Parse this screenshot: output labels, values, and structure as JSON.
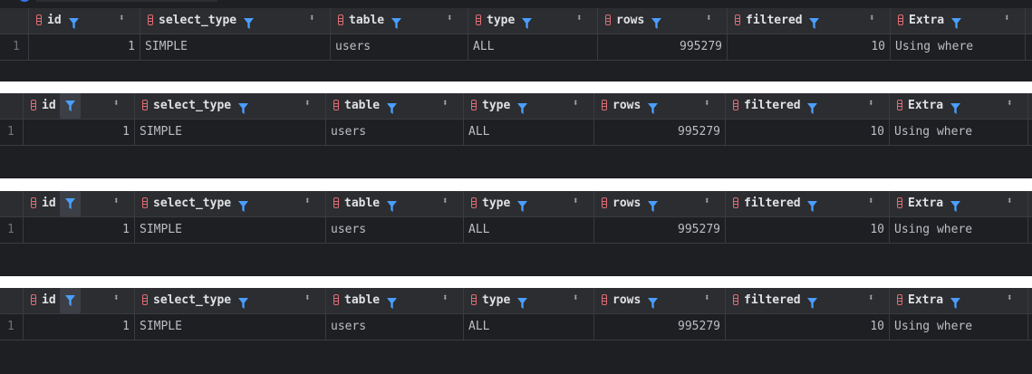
{
  "columns": [
    {
      "name": "id"
    },
    {
      "name": "select_type"
    },
    {
      "name": "table"
    },
    {
      "name": "type"
    },
    {
      "name": "rows"
    },
    {
      "name": "filtered"
    },
    {
      "name": "Extra"
    }
  ],
  "row_number": "1",
  "row": {
    "id": "1",
    "select_type": "SIMPLE",
    "table": "users",
    "type": "ALL",
    "rows": "995279",
    "filtered": "10",
    "extra": "Using where"
  },
  "sort_glyph": "⬍",
  "colors": {
    "filter_icon": "#4a9eff",
    "column_icon": "#e06c75",
    "header_bg": "#2b2d30",
    "body_bg": "#1e1f22"
  },
  "icons": {
    "column": "column-icon",
    "filter": "filter-icon",
    "sort": "sort-icon"
  }
}
